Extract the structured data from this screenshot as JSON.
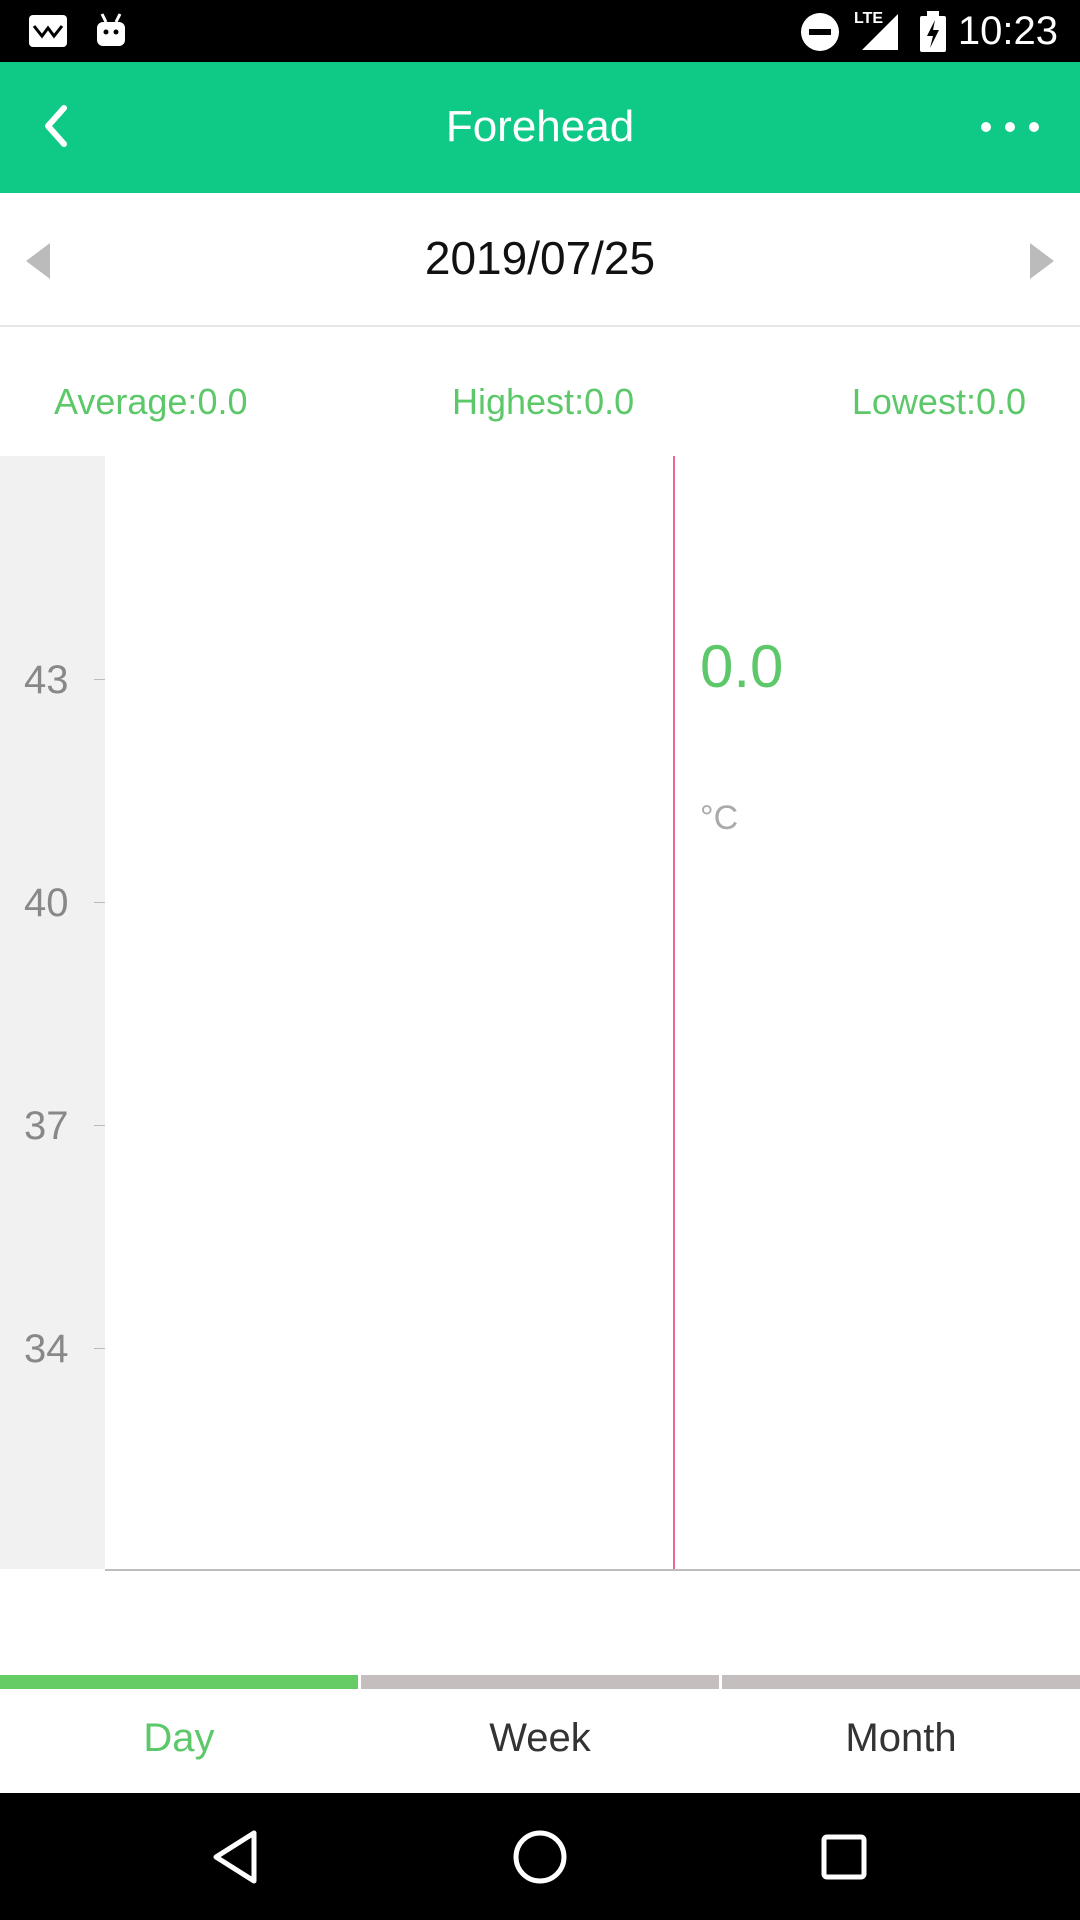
{
  "status_bar": {
    "time": "10:23",
    "network": "LTE",
    "icons": [
      "mail-icon",
      "android-icon",
      "do-not-disturb-icon",
      "signal-icon",
      "battery-charging-icon"
    ]
  },
  "header": {
    "title": "Forehead",
    "back_icon": "chevron-left-icon",
    "menu_icon": "more-dots-icon",
    "color": "#0fc987"
  },
  "date_nav": {
    "date": "2019/07/25",
    "prev_icon": "triangle-left-icon",
    "next_icon": "triangle-right-icon"
  },
  "stats": {
    "average": "Average:0.0",
    "highest": "Highest:0.0",
    "lowest": "Lowest:0.0"
  },
  "chart": {
    "y_ticks": [
      "43",
      "40",
      "37",
      "34"
    ],
    "cursor_value": "0.0",
    "unit": "°C",
    "accent": "#5dc86a",
    "cursor_color": "#e86b94"
  },
  "tabs": [
    {
      "label": "Day",
      "active": true
    },
    {
      "label": "Week",
      "active": false
    },
    {
      "label": "Month",
      "active": false
    }
  ],
  "nav_bar": {
    "icons": [
      "back-triangle-icon",
      "home-circle-icon",
      "recents-square-icon"
    ]
  }
}
